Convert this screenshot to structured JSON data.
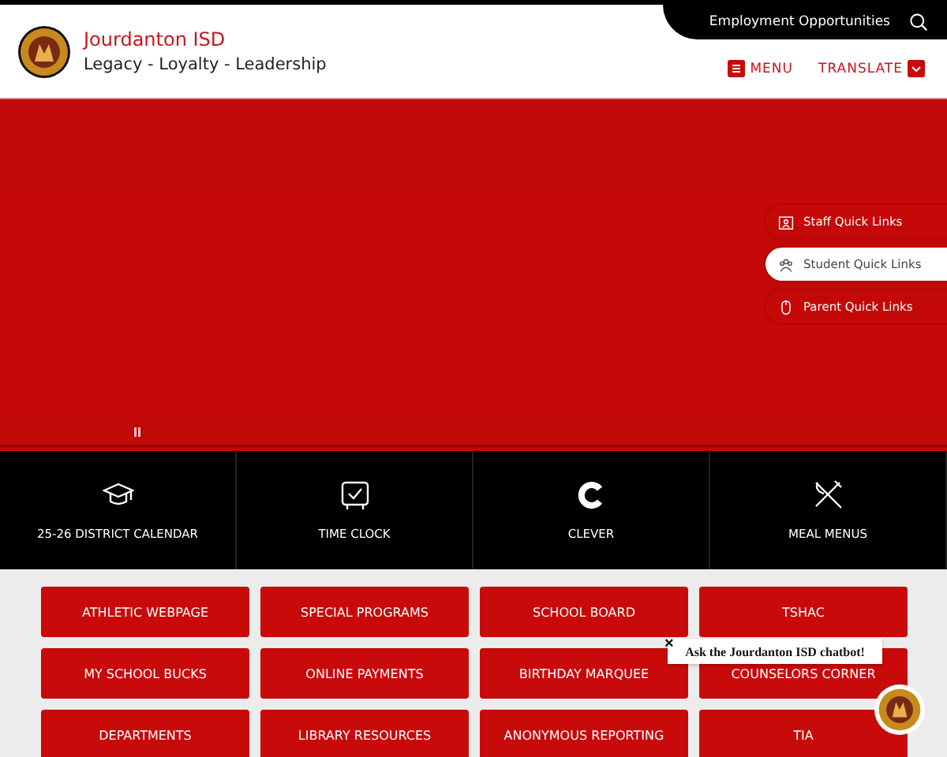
{
  "header": {
    "title": "Jourdanton ISD",
    "tagline": "Legacy - Loyalty - Leadership",
    "top_link": "Employment Opportunities",
    "menu": "MENU",
    "translate": "TRANSLATE"
  },
  "quick_links": [
    {
      "label": "Staff Quick Links",
      "kind": "staff",
      "selected": false
    },
    {
      "label": "Student Quick Links",
      "kind": "student",
      "selected": true
    },
    {
      "label": "Parent Quick Links",
      "kind": "parent",
      "selected": false
    }
  ],
  "features": [
    {
      "label": "25-26 DISTRICT CALENDAR",
      "kind": "cap"
    },
    {
      "label": "TIME CLOCK",
      "kind": "clock"
    },
    {
      "label": "CLEVER",
      "kind": "clever"
    },
    {
      "label": "MEAL MENUS",
      "kind": "meal"
    }
  ],
  "buttons": [
    "ATHLETIC WEBPAGE",
    "SPECIAL PROGRAMS",
    "SCHOOL BOARD",
    "TSHAC",
    "MY SCHOOL BUCKS",
    "ONLINE PAYMENTS",
    "BIRTHDAY MARQUEE",
    "COUNSELORS CORNER",
    "DEPARTMENTS",
    "LIBRARY RESOURCES",
    "ANONYMOUS REPORTING",
    "TIA"
  ],
  "chatbot": {
    "prompt": "Ask the Jourdanton ISD chatbot!",
    "close": "×"
  }
}
